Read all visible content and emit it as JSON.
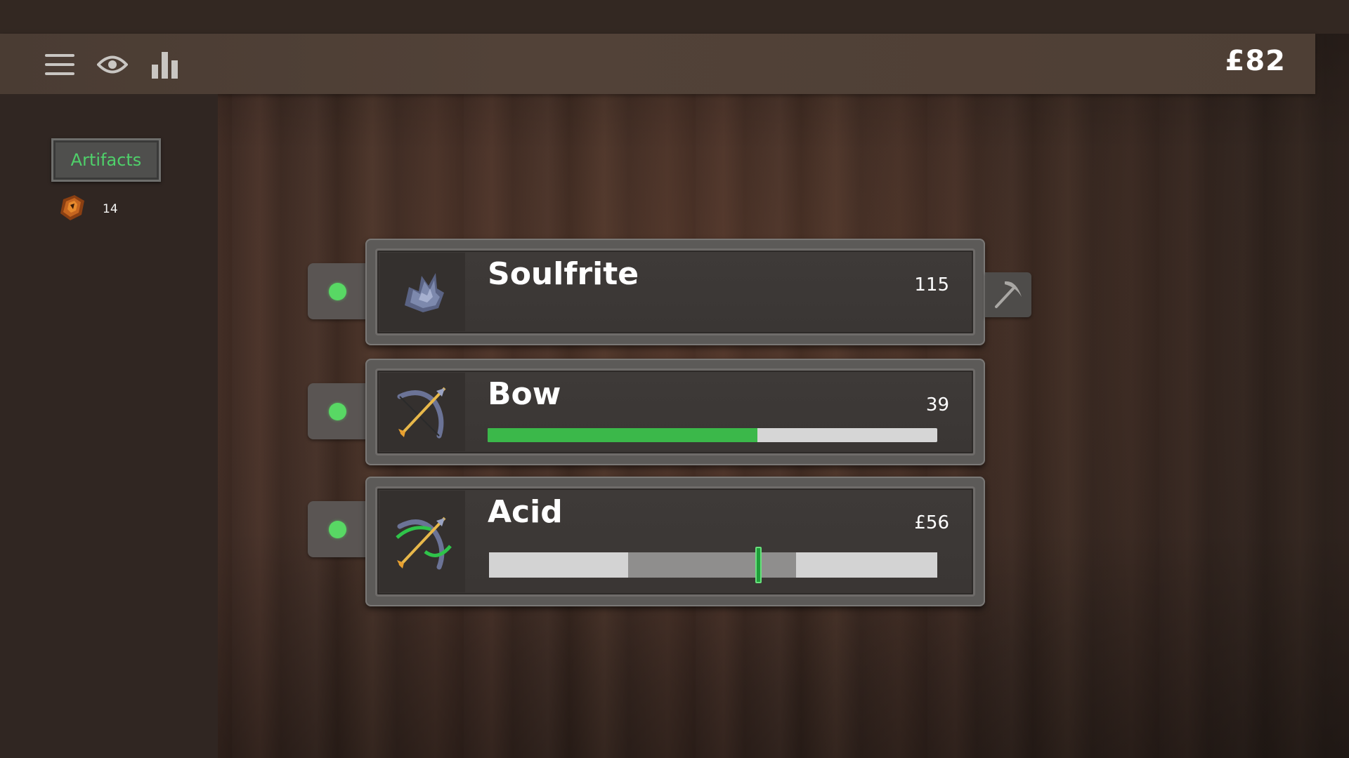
{
  "header": {
    "currency": "£82",
    "icons": [
      "menu-icon",
      "eye-icon",
      "bar-chart-icon"
    ]
  },
  "sidebar": {
    "tab_label": "Artifacts",
    "resource": {
      "icon": "artifact-shard-icon",
      "count": "14"
    }
  },
  "items": [
    {
      "name": "Soulfrite",
      "value": "115",
      "icon": "soulfrite-ore-icon",
      "active": true,
      "action_icon": "pickaxe-icon"
    },
    {
      "name": "Bow",
      "value": "39",
      "icon": "bow-icon",
      "active": true,
      "progress": 0.6
    },
    {
      "name": "Acid",
      "value": "£56",
      "icon": "acid-bow-icon",
      "active": true,
      "slider": {
        "range_start": 0.31,
        "range_end": 0.685,
        "handle": 0.6
      }
    }
  ],
  "colors": {
    "active_dot": "#58d864",
    "progress_fill": "#3bb84a",
    "tab_text": "#4fd06a"
  }
}
